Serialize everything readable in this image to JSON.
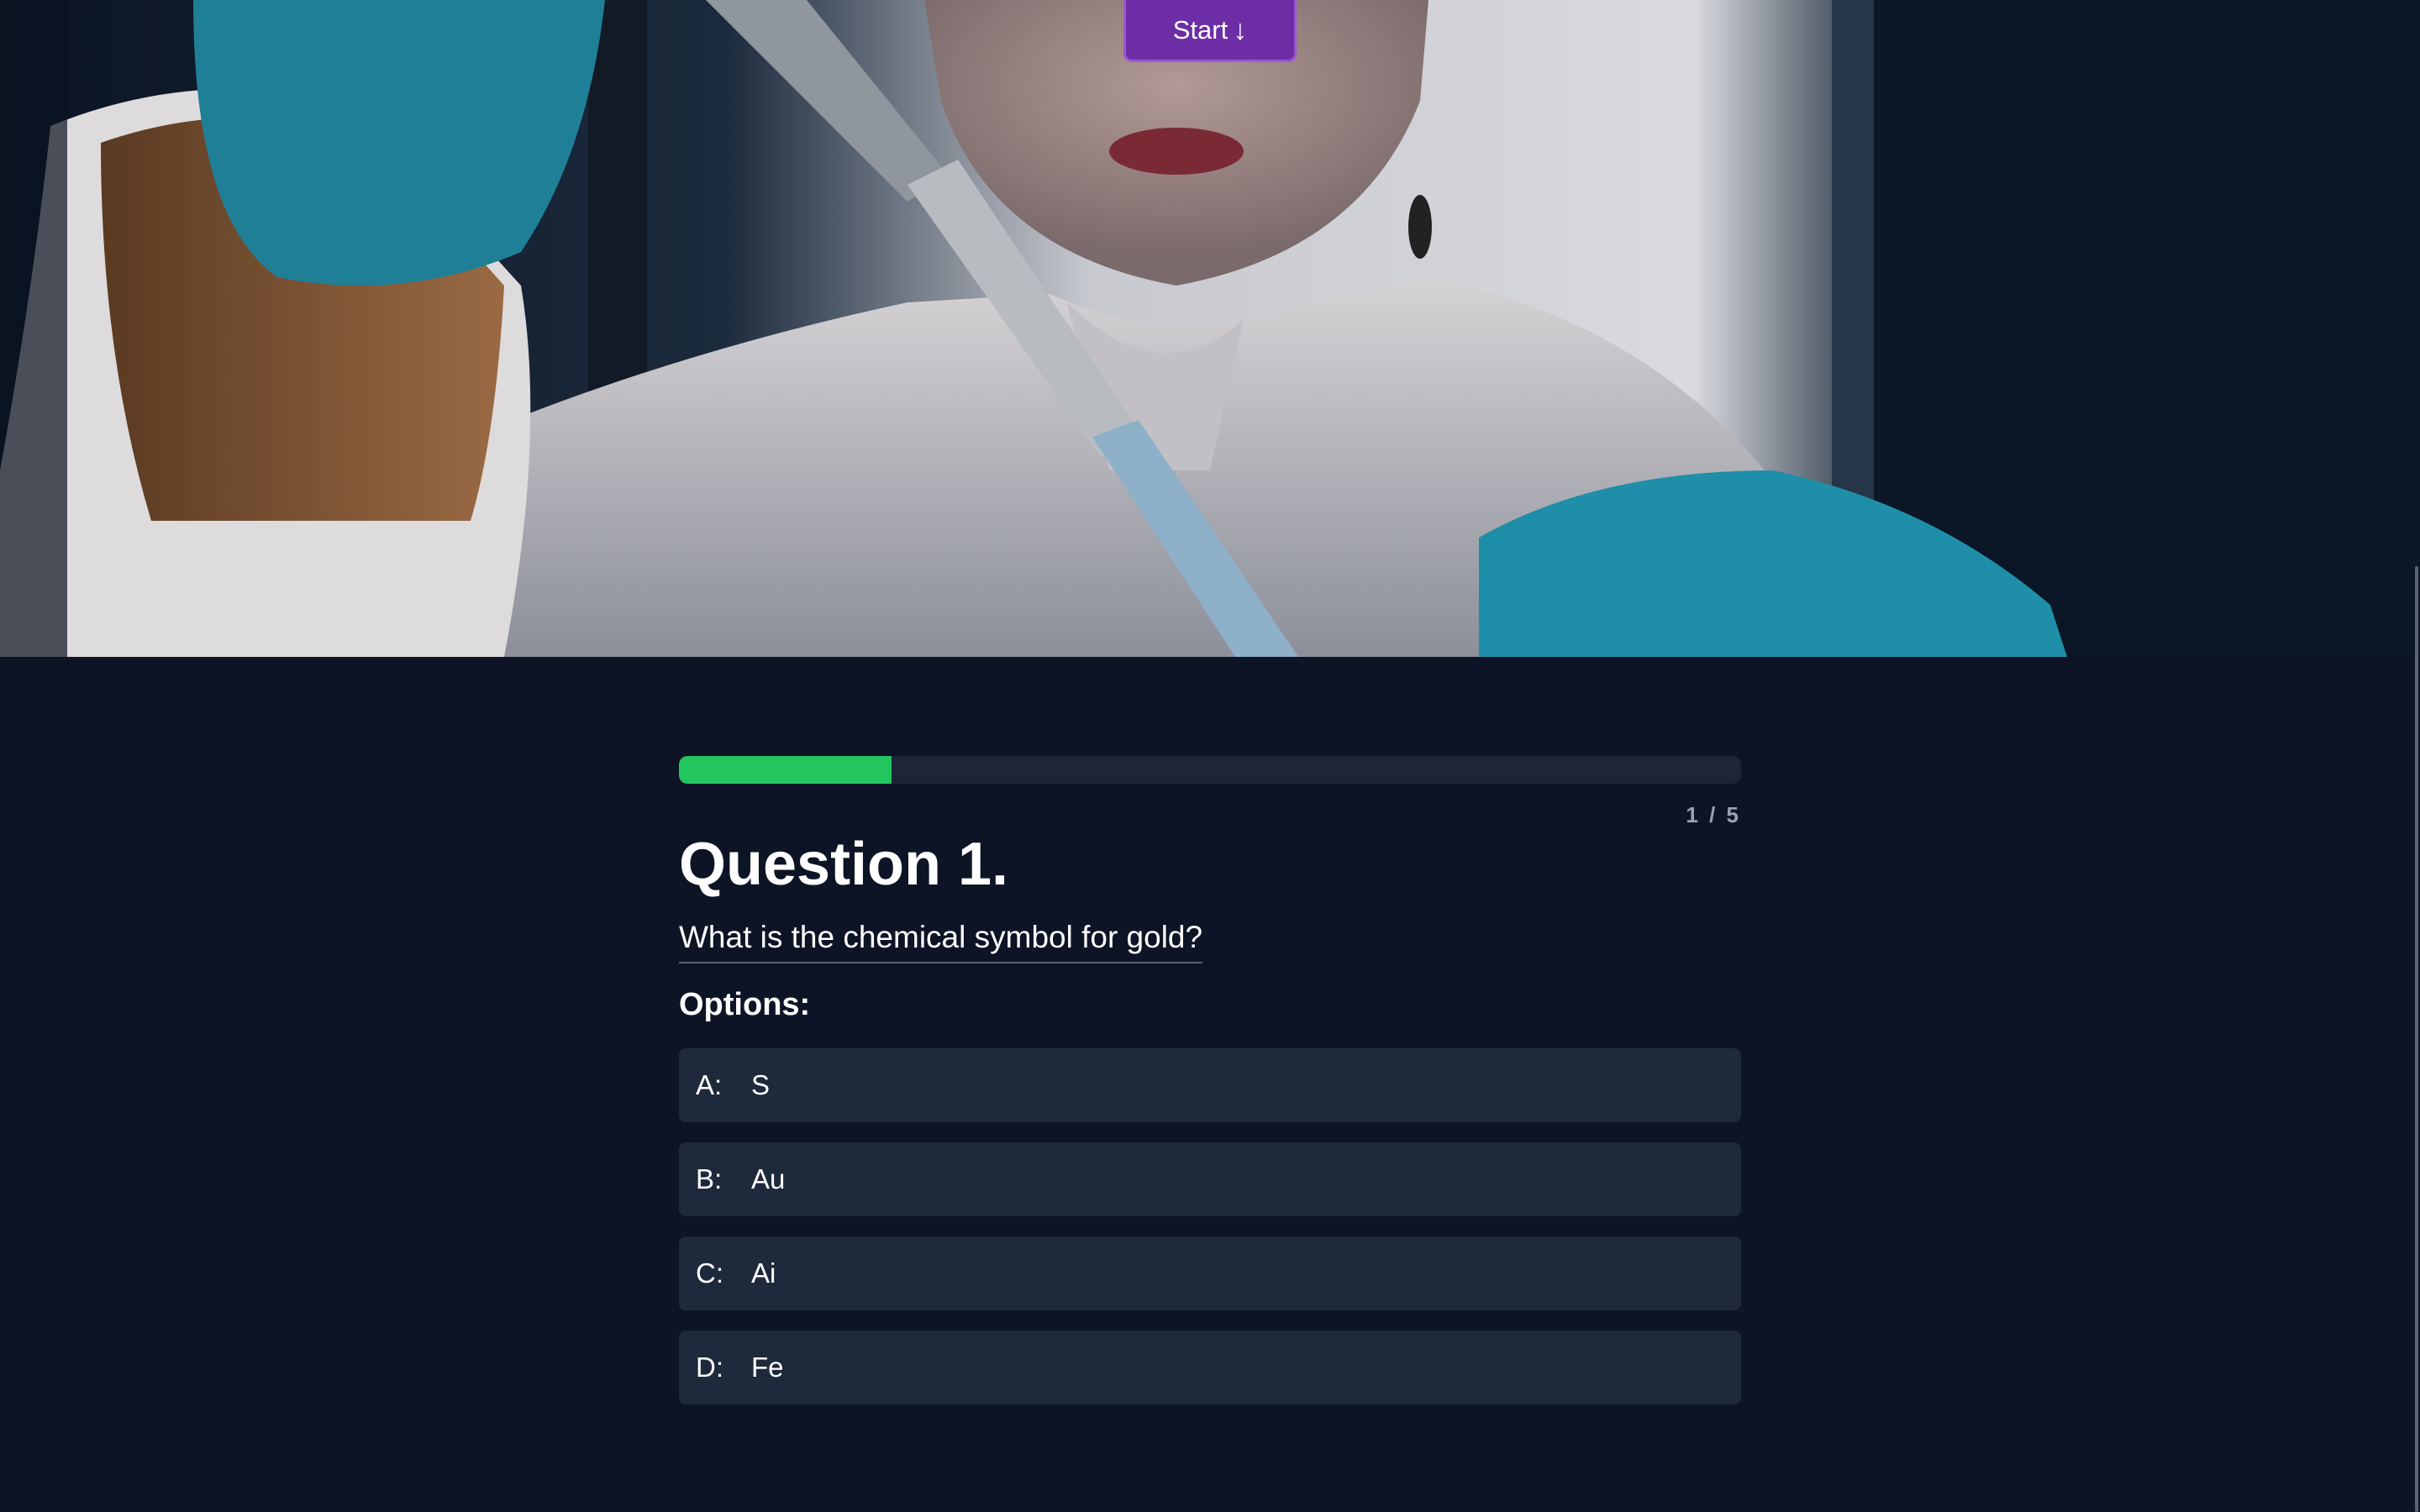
{
  "hero": {
    "start_label": "Start",
    "start_icon": "arrow-down-icon"
  },
  "quiz": {
    "progress": 0.2,
    "progress_color": "#22c55e",
    "counter": "1 / 5",
    "title": "Question 1.",
    "question": "What is the chemical symbol for gold?",
    "options_label": "Options:",
    "options": [
      {
        "letter": "A:",
        "text": "S"
      },
      {
        "letter": "B:",
        "text": "Au"
      },
      {
        "letter": "C:",
        "text": "Ai"
      },
      {
        "letter": "D:",
        "text": "Fe"
      }
    ]
  }
}
